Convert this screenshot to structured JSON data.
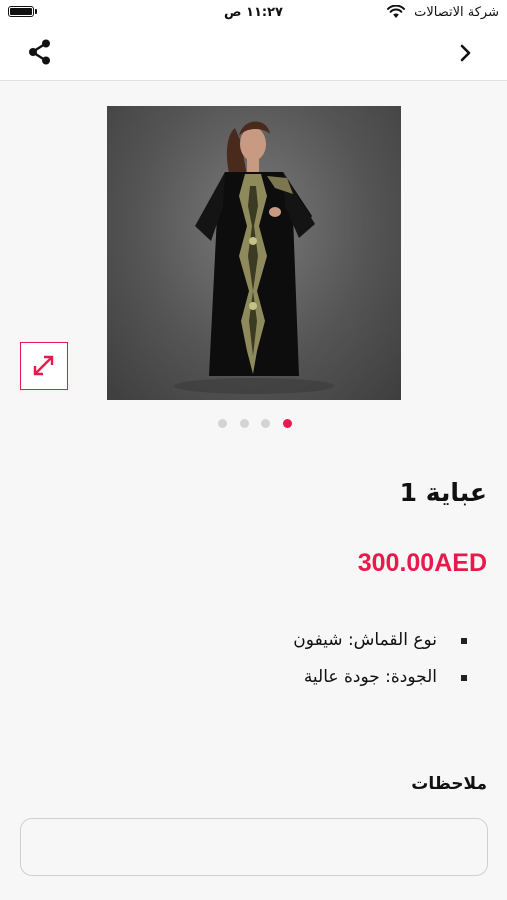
{
  "status_bar": {
    "time": "١١:٢٧ ص",
    "carrier": "شركة الاتصالات"
  },
  "nav": {
    "share_icon": "share-icon",
    "back_icon": "chevron-right-icon"
  },
  "gallery": {
    "image_count": 4,
    "active_index": 3,
    "expand_icon": "expand-icon"
  },
  "product": {
    "title": "عباية 1",
    "price": "300.00AED",
    "features": [
      "نوع القماش: شيفون",
      "الجودة: جودة عالية"
    ]
  },
  "notes": {
    "label": "ملاحظات",
    "value": ""
  },
  "colors": {
    "accent": "#e8194b",
    "background": "#f7f7f7"
  }
}
